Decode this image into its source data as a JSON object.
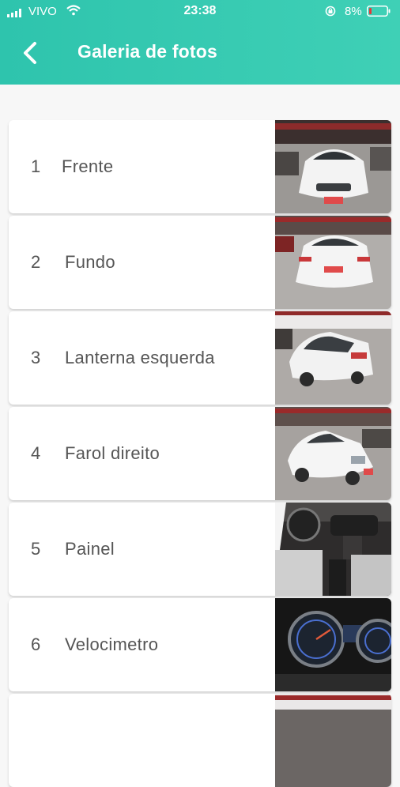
{
  "status_bar": {
    "carrier": "VIVO",
    "time": "23:38",
    "battery": "8%"
  },
  "header": {
    "title": "Galeria de fotos",
    "back_icon": "chevron-left-icon"
  },
  "colors": {
    "header": "#33c7b0",
    "background": "#f7f7f7",
    "card": "#ffffff",
    "text": "#555555"
  },
  "photos": [
    {
      "number": "1",
      "label": "Frente",
      "thumbnail": "car-front-photo"
    },
    {
      "number": "2",
      "label": "Fundo",
      "thumbnail": "car-rear-photo"
    },
    {
      "number": "3",
      "label": "Lanterna esquerda",
      "thumbnail": "car-left-taillight-photo"
    },
    {
      "number": "4",
      "label": "Farol direito",
      "thumbnail": "car-right-headlight-photo"
    },
    {
      "number": "5",
      "label": "Painel",
      "thumbnail": "dashboard-photo"
    },
    {
      "number": "6",
      "label": "Velocimetro",
      "thumbnail": "speedometer-photo"
    }
  ]
}
